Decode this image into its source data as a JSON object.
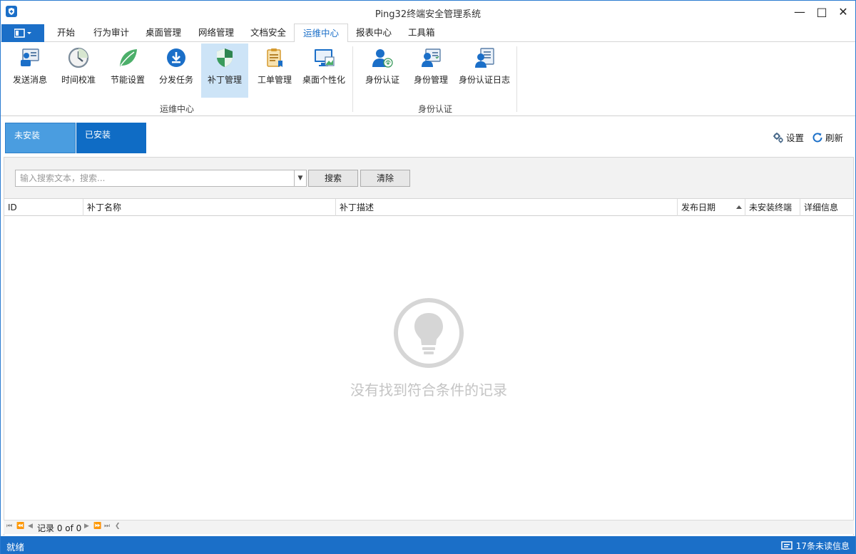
{
  "window": {
    "title": "Ping32终端安全管理系统"
  },
  "tabs": [
    {
      "label": "开始"
    },
    {
      "label": "行为审计"
    },
    {
      "label": "桌面管理"
    },
    {
      "label": "网络管理"
    },
    {
      "label": "文档安全"
    },
    {
      "label": "运维中心",
      "active": true
    },
    {
      "label": "报表中心"
    },
    {
      "label": "工具箱"
    }
  ],
  "ribbon": {
    "groups": [
      {
        "label": "运维中心"
      },
      {
        "label": "身份认证"
      }
    ],
    "buttons": [
      {
        "label": "发送消息",
        "icon": "send-message-icon"
      },
      {
        "label": "时间校准",
        "icon": "clock-icon"
      },
      {
        "label": "节能设置",
        "icon": "leaf-icon"
      },
      {
        "label": "分发任务",
        "icon": "download-icon"
      },
      {
        "label": "补丁管理",
        "icon": "shield-icon",
        "active": true
      },
      {
        "label": "工单管理",
        "icon": "clipboard-icon"
      },
      {
        "label": "桌面个性化",
        "icon": "monitor-icon"
      },
      {
        "label": "身份认证",
        "icon": "fingerprint-user-icon"
      },
      {
        "label": "身份管理",
        "icon": "id-card-icon"
      },
      {
        "label": "身份认证日志",
        "icon": "user-log-icon"
      }
    ]
  },
  "subtabs": [
    {
      "label": "未安装",
      "active": true
    },
    {
      "label": "已安装"
    }
  ],
  "toolbar": {
    "settings": "设置",
    "refresh": "刷新"
  },
  "search": {
    "placeholder": "输入搜索文本，搜索...",
    "search_button": "搜索",
    "clear_button": "清除"
  },
  "grid": {
    "columns": [
      "ID",
      "补丁名称",
      "补丁描述",
      "发布日期",
      "未安装终端",
      "详细信息"
    ],
    "empty_message": "没有找到符合条件的记录"
  },
  "pager": {
    "record_text": "记录 0 of 0"
  },
  "status": {
    "text": "就绪",
    "messages": "17条未读信息"
  },
  "colors": {
    "accent": "#1b6fc8",
    "active_ribbon": "#cde4f7",
    "shield_green": "#3a9b5c"
  }
}
